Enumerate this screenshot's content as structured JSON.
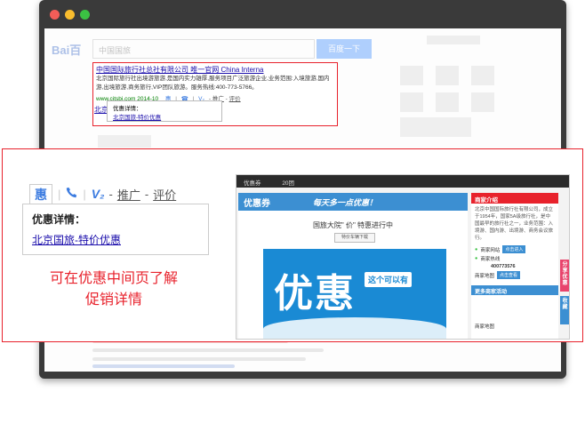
{
  "colors": {
    "accent_red": "#e8222c",
    "link_blue": "#1a0dab",
    "brand_blue": "#3385ff",
    "window_dark": "#3a3a3a",
    "traffic_red": "#f25d58",
    "traffic_yellow": "#f9bd2e",
    "traffic_green": "#3bc243"
  },
  "search_result": {
    "title": "中国国际旅行社总社有限公司 唯一官网 China Interna",
    "description": "北京国际旅行社出境游旅游,是国内实力雄厚,服务项目广泛旅游企业,业务范围:入境旅游,国内游,出境旅游,商务旅行,VIP团队旅游。服务热线:400-773-5766。",
    "url": "www.citsbj.com 2014-10",
    "icon_links": [
      "推广",
      "评价"
    ],
    "second_title": "北京国际旅行社旅游网",
    "popup_heading": "优惠详情：",
    "popup_link": "北京国旅-特价优惠"
  },
  "zoom": {
    "icon_hui": "惠",
    "icon_phone": "phone-icon",
    "icon_v2": "V₂",
    "link_promote": "推广",
    "link_review": "评价",
    "dash": "-",
    "detail_heading": "优惠详情：",
    "detail_link": "北京国旅-特价优惠"
  },
  "caption_lines": [
    "可在优惠中间页了解",
    "促销详情"
  ],
  "landing": {
    "top_nav": [
      "优惠券",
      "20团"
    ],
    "banner_tag": "优惠券",
    "banner_slogan": "每天多一点优惠！",
    "headline": "国旅大院\" 价\" 特惠进行中",
    "small_button": "特价车辆下载",
    "hero_big": "优惠",
    "hero_small": "这个可以有",
    "side_head": "商家介绍",
    "side_text": "北京中国国际旅行社有限公司，成立于1954年，国家5A级旅行社，是中国最早的旅行社之一，业务范围：入境游、国内游、出境游、商务会议旅行。",
    "side_rows": [
      "商家网站",
      "商家热线",
      "400773576",
      "商家地图"
    ],
    "side_btn1": "点击进入",
    "side_btn2": "点击查看",
    "side_sub": "更多商家活动",
    "side_sub2": "商家地图",
    "tab_red": "分享优惠",
    "tab_blue": "收藏"
  }
}
